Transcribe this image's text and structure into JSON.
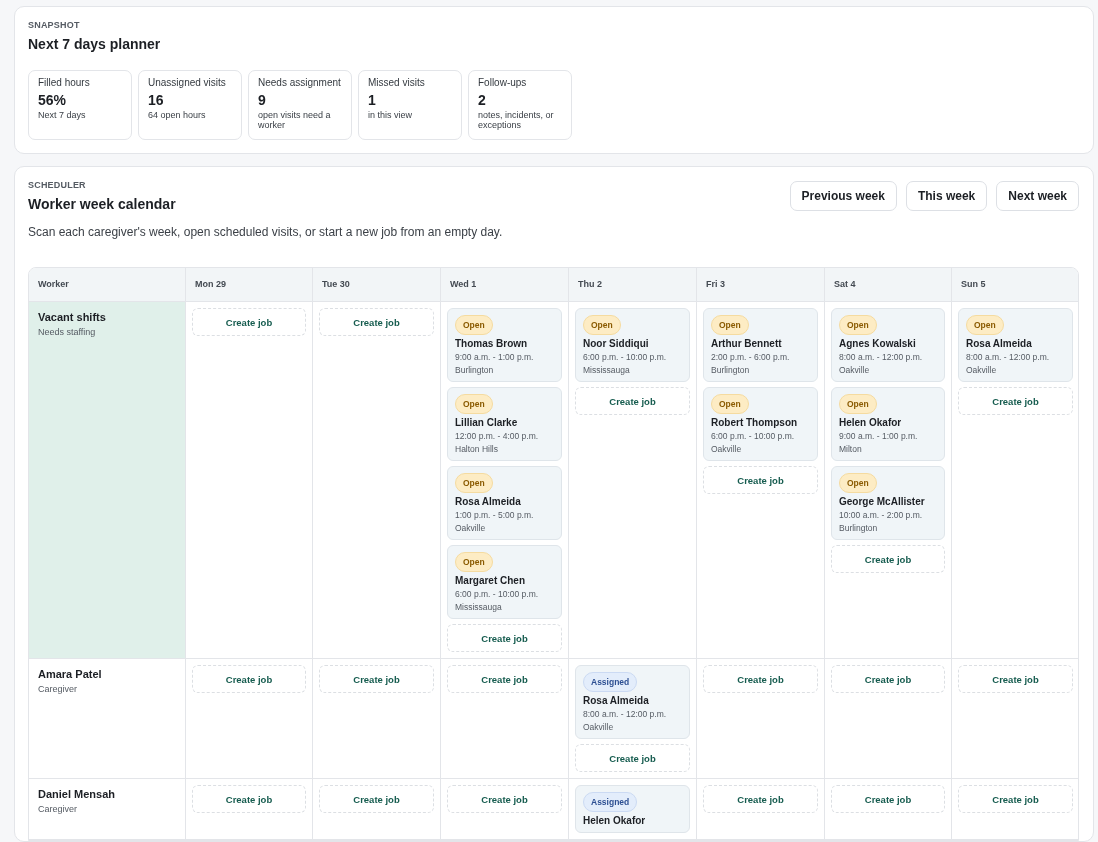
{
  "snapshot": {
    "eyebrow": "SNAPSHOT",
    "title": "Next 7 days planner",
    "stats": [
      {
        "label": "Filled hours",
        "value": "56%",
        "note": "Next 7 days"
      },
      {
        "label": "Unassigned visits",
        "value": "16",
        "note": "64 open hours"
      },
      {
        "label": "Needs assignment",
        "value": "9",
        "note": "open visits need a worker"
      },
      {
        "label": "Missed visits",
        "value": "1",
        "note": "in this view"
      },
      {
        "label": "Follow-ups",
        "value": "2",
        "note": "notes, incidents, or exceptions"
      }
    ]
  },
  "scheduler": {
    "eyebrow": "SCHEDULER",
    "title": "Worker week calendar",
    "buttons": [
      "Previous week",
      "This week",
      "Next week"
    ],
    "description": "Scan each caregiver's week, open scheduled visits, or start a new job from an empty day.",
    "columns": [
      "Worker",
      "Mon 29",
      "Tue 30",
      "Wed 1",
      "Thu 2",
      "Fri 3",
      "Sat 4",
      "Sun 5"
    ],
    "rows": [
      {
        "name": "Vacant shifts",
        "role": "Needs staffing",
        "highlighted": true,
        "days": [
          [
            {
              "kind": "create",
              "label": "Create job"
            }
          ],
          [
            {
              "kind": "create",
              "label": "Create job"
            }
          ],
          [
            {
              "kind": "open",
              "badge": "Open",
              "client": "Thomas Brown",
              "time": "9:00 a.m. - 1:00 p.m.",
              "place": "Burlington"
            },
            {
              "kind": "open",
              "badge": "Open",
              "client": "Lillian Clarke",
              "time": "12:00 p.m. - 4:00 p.m.",
              "place": "Halton Hills"
            },
            {
              "kind": "open",
              "badge": "Open",
              "client": "Rosa Almeida",
              "time": "1:00 p.m. - 5:00 p.m.",
              "place": "Oakville"
            },
            {
              "kind": "open",
              "badge": "Open",
              "client": "Margaret Chen",
              "time": "6:00 p.m. - 10:00 p.m.",
              "place": "Mississauga"
            },
            {
              "kind": "create",
              "label": "Create job"
            }
          ],
          [
            {
              "kind": "open",
              "badge": "Open",
              "client": "Noor Siddiqui",
              "time": "6:00 p.m. - 10:00 p.m.",
              "place": "Mississauga"
            },
            {
              "kind": "create",
              "label": "Create job"
            }
          ],
          [
            {
              "kind": "open",
              "badge": "Open",
              "client": "Arthur Bennett",
              "time": "2:00 p.m. - 6:00 p.m.",
              "place": "Burlington"
            },
            {
              "kind": "open",
              "badge": "Open",
              "client": "Robert Thompson",
              "time": "6:00 p.m. - 10:00 p.m.",
              "place": "Oakville"
            },
            {
              "kind": "create",
              "label": "Create job"
            }
          ],
          [
            {
              "kind": "open",
              "badge": "Open",
              "client": "Agnes Kowalski",
              "time": "8:00 a.m. - 12:00 p.m.",
              "place": "Oakville"
            },
            {
              "kind": "open",
              "badge": "Open",
              "client": "Helen Okafor",
              "time": "9:00 a.m. - 1:00 p.m.",
              "place": "Milton"
            },
            {
              "kind": "open",
              "badge": "Open",
              "client": "George McAllister",
              "time": "10:00 a.m. - 2:00 p.m.",
              "place": "Burlington"
            },
            {
              "kind": "create",
              "label": "Create job"
            }
          ],
          [
            {
              "kind": "open",
              "badge": "Open",
              "client": "Rosa Almeida",
              "time": "8:00 a.m. - 12:00 p.m.",
              "place": "Oakville"
            },
            {
              "kind": "create",
              "label": "Create job"
            }
          ]
        ]
      },
      {
        "name": "Amara Patel",
        "role": "Caregiver",
        "highlighted": false,
        "days": [
          [
            {
              "kind": "create",
              "label": "Create job"
            }
          ],
          [
            {
              "kind": "create",
              "label": "Create job"
            }
          ],
          [
            {
              "kind": "create",
              "label": "Create job"
            }
          ],
          [
            {
              "kind": "assigned",
              "badge": "Assigned",
              "client": "Rosa Almeida",
              "time": "8:00 a.m. - 12:00 p.m.",
              "place": "Oakville"
            },
            {
              "kind": "create",
              "label": "Create job"
            }
          ],
          [
            {
              "kind": "create",
              "label": "Create job"
            }
          ],
          [
            {
              "kind": "create",
              "label": "Create job"
            }
          ],
          [
            {
              "kind": "create",
              "label": "Create job"
            }
          ]
        ]
      },
      {
        "name": "Daniel Mensah",
        "role": "Caregiver",
        "highlighted": false,
        "days": [
          [
            {
              "kind": "create",
              "label": "Create job"
            }
          ],
          [
            {
              "kind": "create",
              "label": "Create job"
            }
          ],
          [
            {
              "kind": "create",
              "label": "Create job"
            }
          ],
          [
            {
              "kind": "assigned",
              "badge": "Assigned",
              "client": "Helen Okafor"
            }
          ],
          [
            {
              "kind": "create",
              "label": "Create job"
            }
          ],
          [
            {
              "kind": "create",
              "label": "Create job"
            }
          ],
          [
            {
              "kind": "create",
              "label": "Create job"
            }
          ]
        ]
      }
    ]
  }
}
